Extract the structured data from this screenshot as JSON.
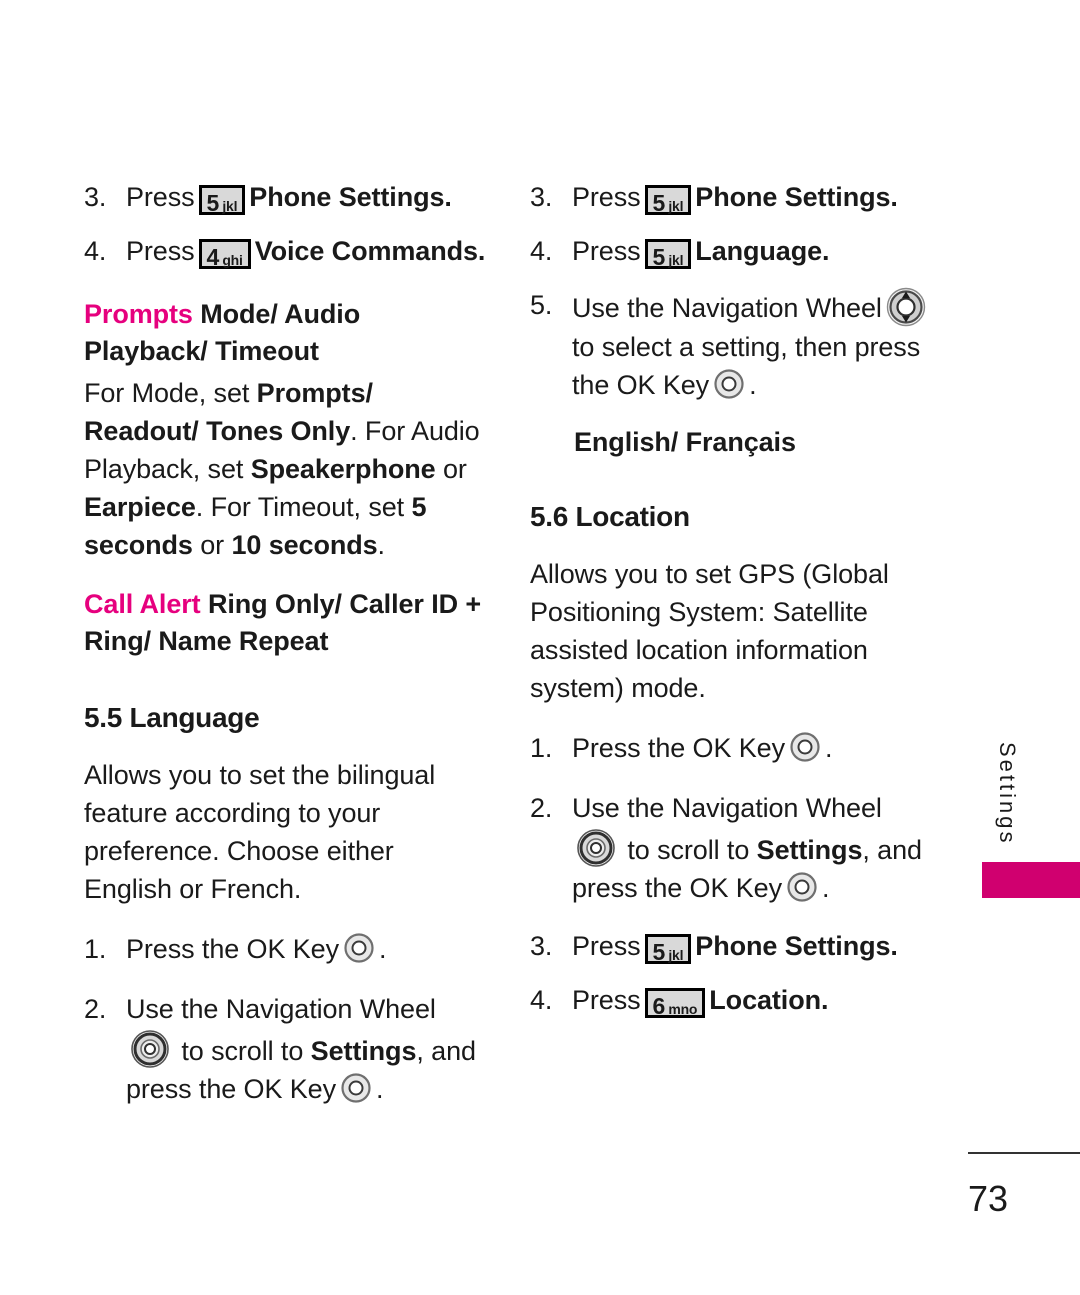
{
  "page": {
    "number": "73",
    "side_tab_label": "Settings",
    "accent_color": "#D0006F",
    "highlight_color": "#E6007E"
  },
  "keys": {
    "five": {
      "digit": "5",
      "letters": "jkl"
    },
    "four": {
      "digit": "4",
      "letters": "ghi"
    },
    "six": {
      "digit": "6",
      "letters": "mno"
    }
  },
  "left_column": {
    "step3": {
      "num": "3.",
      "press": "Press",
      "tail": "Phone Settings."
    },
    "step4": {
      "num": "4.",
      "press": "Press",
      "tail": "Voice Commands."
    },
    "prompts_subhead": {
      "label": "Prompts",
      "rest": " Mode/ Audio Playback/ Timeout"
    },
    "prompts_body": {
      "p1": "For Mode, set ",
      "b1": "Prompts/ Readout/ Tones Only",
      "p2": ". For Audio Playback, set ",
      "b2": "Speakerphone",
      "p3": " or ",
      "b3": "Earpiece",
      "p4": ". For Timeout, set ",
      "b4": "5 seconds",
      "p5": " or ",
      "b5": "10 seconds",
      "p6": "."
    },
    "call_alert_subhead": {
      "label": "Call Alert",
      "rest": " Ring Only/ Caller ID + Ring/ Name Repeat"
    },
    "section_heading": "5.5 Language",
    "intro": "Allows you to set the bilingual feature according to your preference. Choose either English or French.",
    "step1": {
      "num": "1.",
      "text": "Press the OK Key",
      "period": "."
    },
    "step2": {
      "num": "2.",
      "line1": "Use the Navigation Wheel",
      "line2_pre": " to scroll to ",
      "line2_bold": "Settings",
      "line2_post": ", and press the OK Key",
      "period": "."
    }
  },
  "right_column": {
    "step3": {
      "num": "3.",
      "press": "Press",
      "tail": "Phone Settings."
    },
    "step4": {
      "num": "4.",
      "press": "Press",
      "tail": "Language."
    },
    "step5": {
      "num": "5.",
      "line1": "Use the Navigation Wheel",
      "line2": "to select a setting, then press the OK Key",
      "period": "."
    },
    "options": "English/ Français",
    "section_heading": "5.6 Location",
    "intro": "Allows you to set GPS (Global Positioning System: Satellite assisted location information system) mode.",
    "step1": {
      "num": "1.",
      "text": "Press the OK Key",
      "period": "."
    },
    "step2": {
      "num": "2.",
      "line1": "Use the Navigation Wheel",
      "line2_pre": " to scroll to ",
      "line2_bold": "Settings",
      "line2_post": ", and press the OK Key",
      "period": "."
    },
    "step3b": {
      "num": "3.",
      "press": "Press",
      "tail": "Phone Settings."
    },
    "step4b": {
      "num": "4.",
      "press": "Press",
      "tail": "Location."
    }
  },
  "icons": {
    "ok_key": "ok-key-icon",
    "nav_wheel": "navigation-wheel-icon",
    "nav_wheel_arrows": "navigation-wheel-arrows-icon"
  }
}
